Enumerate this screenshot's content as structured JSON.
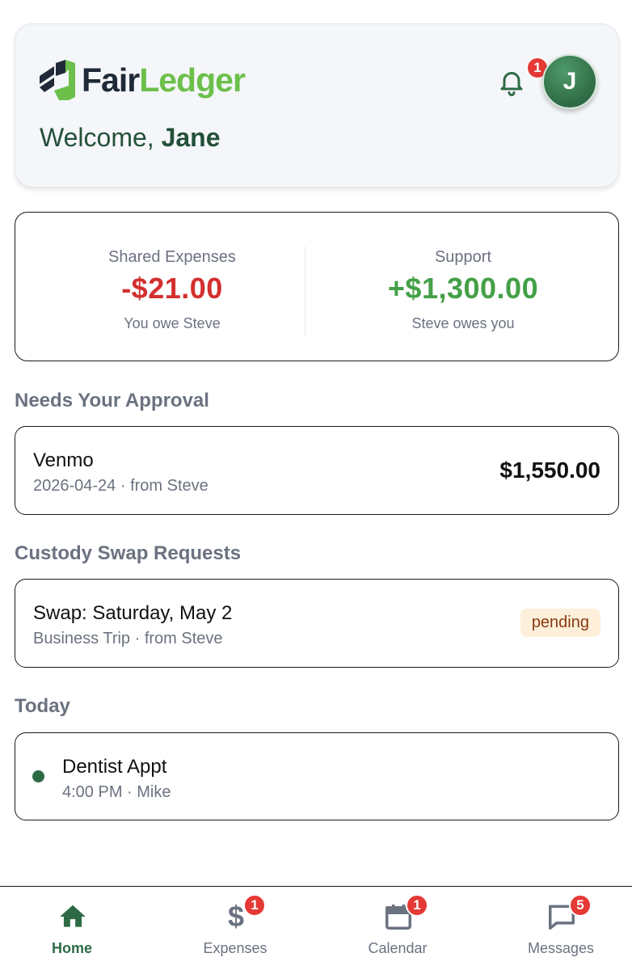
{
  "header": {
    "brand_part1": "Fair",
    "brand_part2": "Ledger",
    "welcome_prefix": "Welcome, ",
    "user_name": "Jane",
    "notification_count": "1",
    "avatar_initial": "J"
  },
  "summary": {
    "shared_expenses": {
      "label": "Shared Expenses",
      "amount": "-$21.00",
      "subtitle": "You owe Steve"
    },
    "support": {
      "label": "Support",
      "amount": "+$1,300.00",
      "subtitle": "Steve owes you"
    }
  },
  "approval": {
    "title": "Needs Your Approval",
    "item": {
      "title": "Venmo",
      "subtitle": "2026-04-24 · from Steve",
      "amount": "$1,550.00"
    }
  },
  "custody": {
    "title": "Custody Swap Requests",
    "item": {
      "title": "Swap: Saturday, May 2",
      "subtitle": "Business Trip · from Steve",
      "status": "pending"
    }
  },
  "today": {
    "title": "Today",
    "item": {
      "title": "Dentist Appt",
      "subtitle": "4:00 PM · Mike"
    }
  },
  "nav": {
    "items": [
      {
        "label": "Home",
        "icon": "home-icon",
        "badge": ""
      },
      {
        "label": "Expenses",
        "icon": "dollar-icon",
        "badge": "1"
      },
      {
        "label": "Calendar",
        "icon": "calendar-icon",
        "badge": "1"
      },
      {
        "label": "Messages",
        "icon": "message-icon",
        "badge": "5"
      }
    ]
  },
  "colors": {
    "brand_dark": "#1f2937",
    "brand_green": "#6cc04a",
    "primary": "#2e6b45",
    "negative": "#d32f2f",
    "positive": "#43a047",
    "badge": "#e53935",
    "pending_bg": "#fdefd9",
    "pending_text": "#8a3a12"
  }
}
